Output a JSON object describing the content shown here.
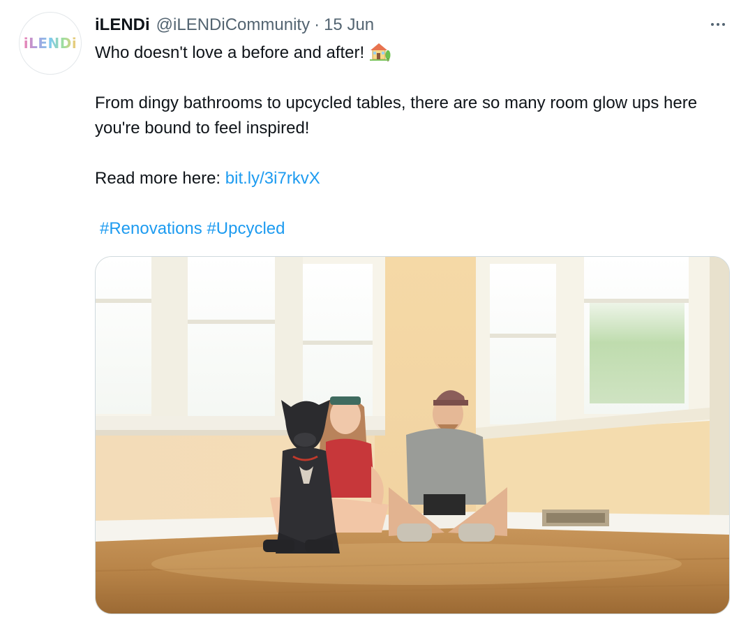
{
  "tweet": {
    "display_name": "iLENDi",
    "handle": "@iLENDiCommunity",
    "separator": "·",
    "date": "15 Jun",
    "avatar_text": "iLENDi",
    "text": {
      "line1": "Who doesn't love a before and after!",
      "line1_emoji": "house-with-garden-emoji",
      "paragraph2": "From dingy bathrooms to upcycled tables, there are so many room glow ups here you're bound to feel inspired!",
      "read_more_label": "Read more here: ",
      "link": "bit.ly/3i7rkvX",
      "hashtag1": "#Renovations",
      "hashtag2": "#Upcycled"
    },
    "media": {
      "description_icon": "photo-image"
    },
    "icons": {
      "more": "more-horizontal-icon"
    },
    "colors": {
      "link": "#1d9bf0",
      "secondary_text": "#536471",
      "primary_text": "#0f1419",
      "border": "#cfd9de"
    }
  }
}
